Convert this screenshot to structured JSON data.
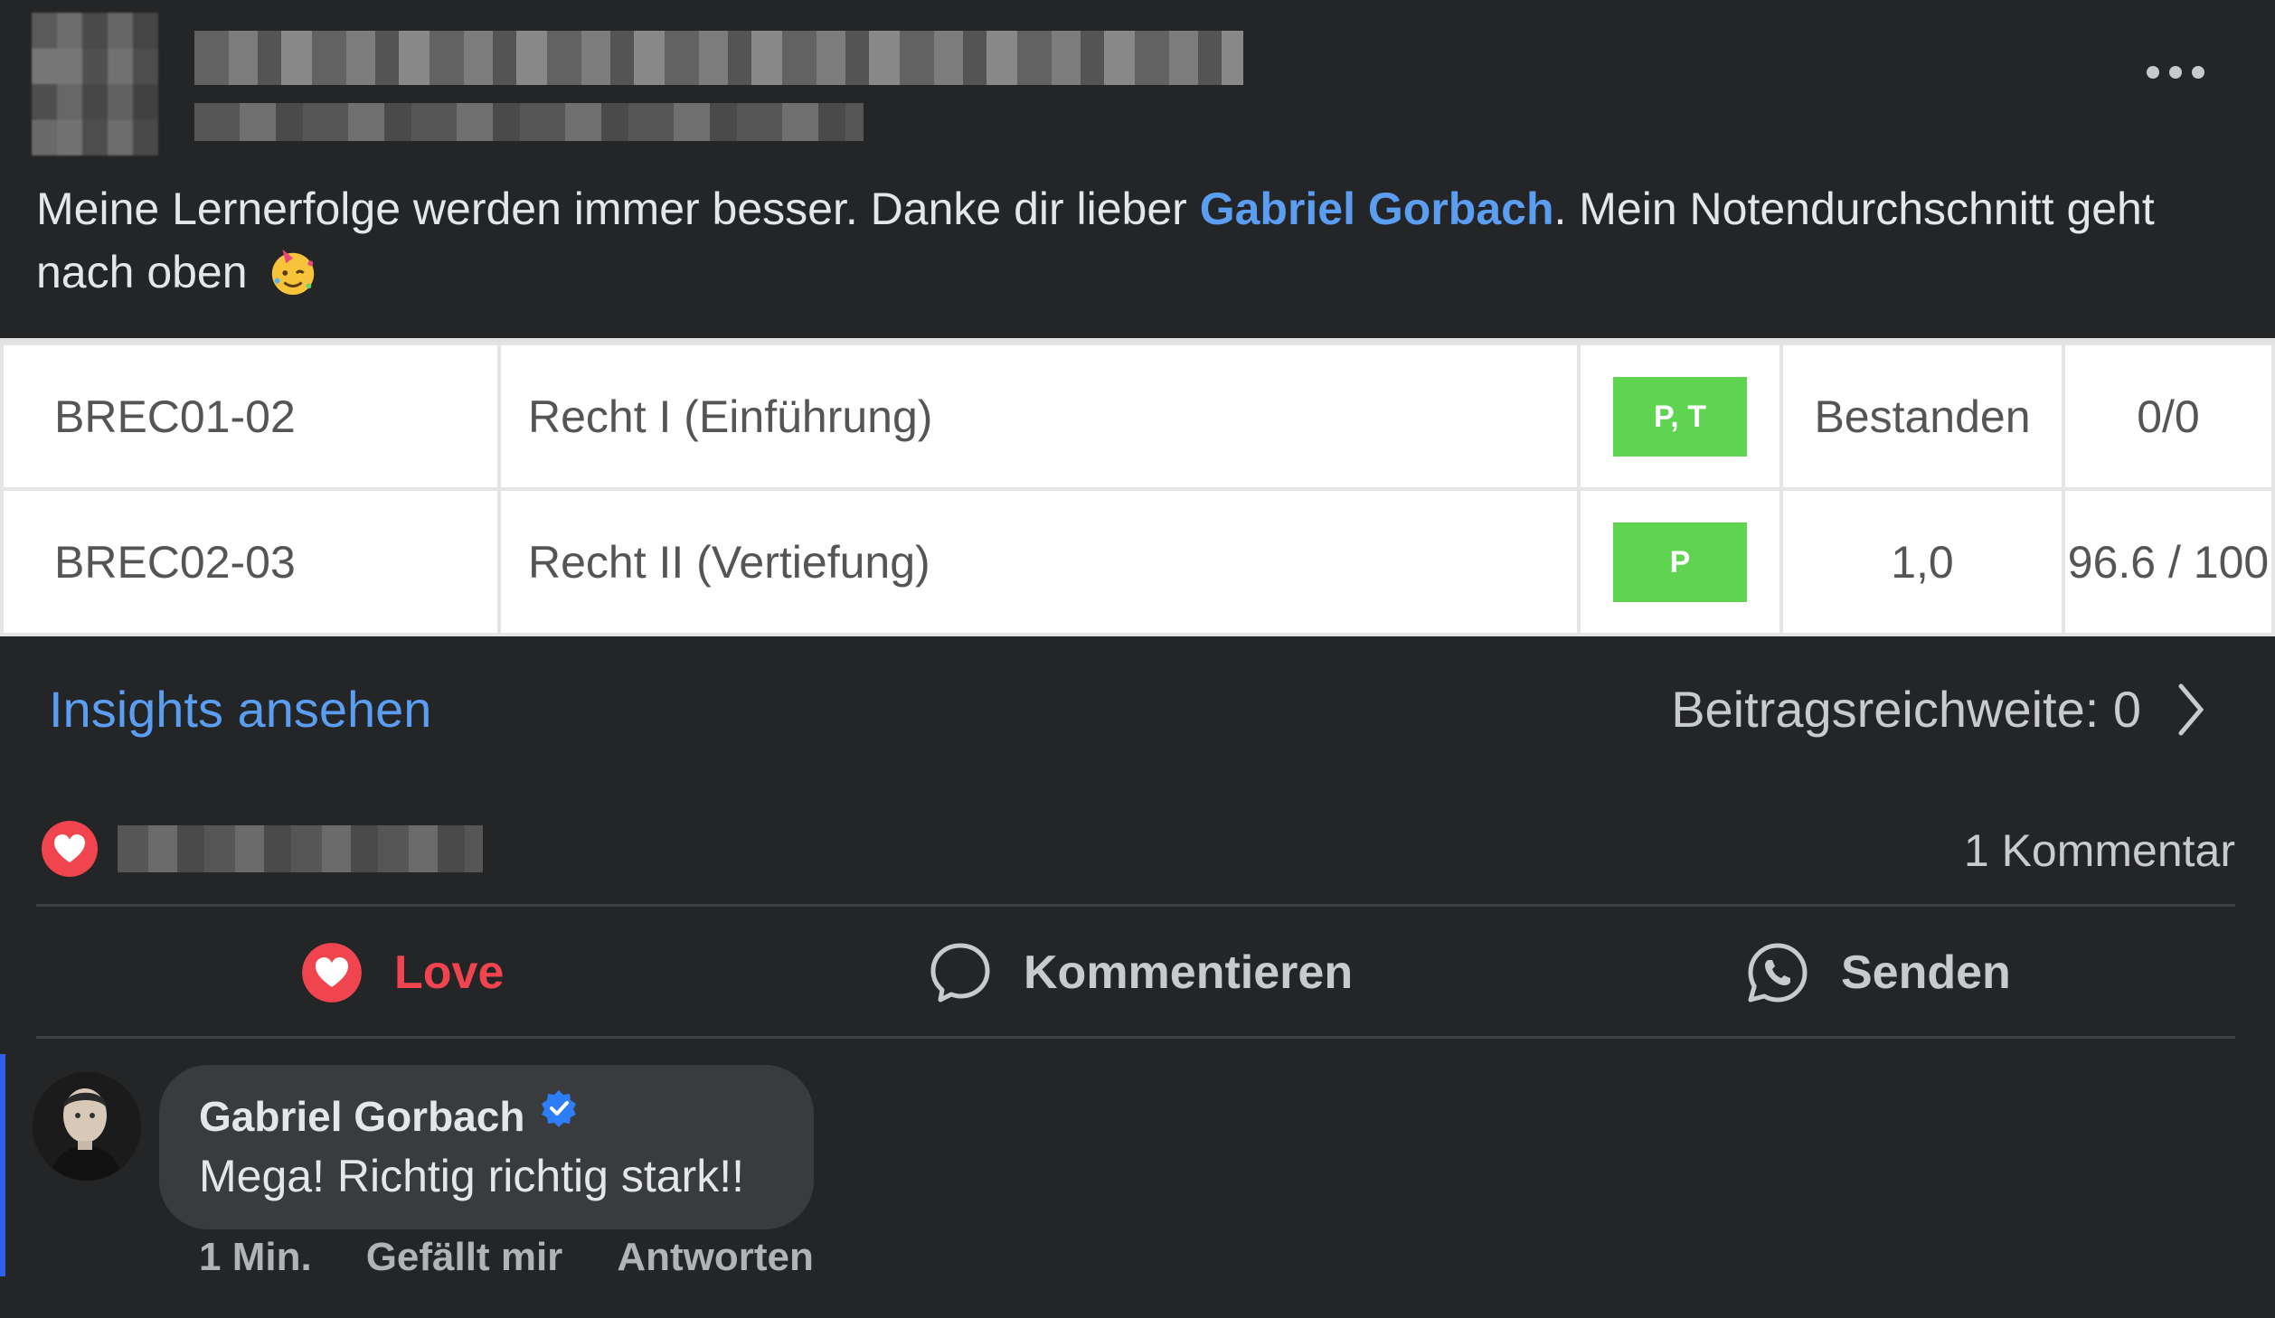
{
  "post": {
    "text_before": "Meine Lernerfolge werden immer besser. Danke dir lieber ",
    "mention": "Gabriel Gorbach",
    "text_after": ". Mein Notendurchschnitt geht nach oben",
    "emoji": "partying-face-emoji",
    "more_icon": "more-dots-icon"
  },
  "grades": [
    {
      "code": "BREC01-02",
      "title": "Recht I (Einführung)",
      "badge": "P, T",
      "result": "Bestanden",
      "points": "0/0"
    },
    {
      "code": "BREC02-03",
      "title": "Recht II (Vertiefung)",
      "badge": "P",
      "result": "1,0",
      "points": "96.6 / 100"
    }
  ],
  "insights": {
    "link_label": "Insights ansehen",
    "reach_label": "Beitragsreichweite: 0",
    "chevron_icon": "chevron-right-icon"
  },
  "reactions": {
    "icon": "heart-reaction-icon",
    "comment_count": "1 Kommentar"
  },
  "actions": {
    "love_label": "Love",
    "comment_label": "Kommentieren",
    "send_label": "Senden"
  },
  "comment": {
    "author": "Gabriel Gorbach",
    "verified_icon": "verified-badge-icon",
    "text": "Mega! Richtig richtig stark!!",
    "time": "1 Min.",
    "like_label": "Gefällt mir",
    "reply_label": "Antworten"
  },
  "colors": {
    "background": "#242526",
    "link": "#5b9df0",
    "love": "#f0454f",
    "badge": "#5fd451",
    "accent": "#2d62e8"
  }
}
